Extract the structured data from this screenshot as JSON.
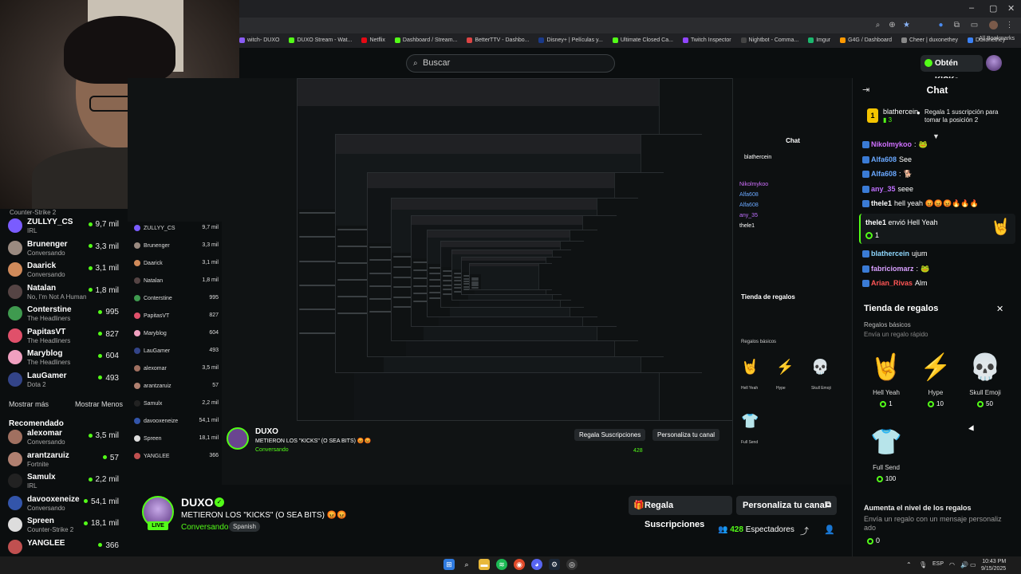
{
  "browser": {
    "tabs_title": "witch- DUXO",
    "bookmarks": [
      {
        "label": "witch- DUXO",
        "color": "#8a5cf5"
      },
      {
        "label": "DUXO Stream - Wat...",
        "color": "#53fc18"
      },
      {
        "label": "Netflix",
        "color": "#e50914"
      },
      {
        "label": "Dashboard / Stream...",
        "color": "#53fc18"
      },
      {
        "label": "BetterTTV - Dashbo...",
        "color": "#d44"
      },
      {
        "label": "Disney+ | Películas y...",
        "color": "#1a3a8a"
      },
      {
        "label": "Ultimate Closed Ca...",
        "color": "#53fc18"
      },
      {
        "label": "Twitch Inspector",
        "color": "#9146ff"
      },
      {
        "label": "Nightbot - Comma...",
        "color": "#444"
      },
      {
        "label": "Imgur",
        "color": "#1bb76e"
      },
      {
        "label": "G4G / Dashboard",
        "color": "#f90"
      },
      {
        "label": "Cheer | duxonethey",
        "color": "#888"
      },
      {
        "label": "Duxonethey",
        "color": "#3b82f6"
      }
    ],
    "all_bookmarks": "All Bookmarks"
  },
  "header": {
    "search_placeholder": "Buscar",
    "kicks_button": "Obtén KICKs"
  },
  "sidebar": {
    "top_category": "Counter-Strike 2",
    "channels": [
      {
        "name": "ZULLYY_CS",
        "game": "IRL",
        "viewers": "9,7 mil",
        "color": "#7a5cff"
      },
      {
        "name": "Brunenger",
        "game": "Conversando",
        "viewers": "3,3 mil",
        "color": "#9a8a80"
      },
      {
        "name": "Daarick",
        "game": "Conversando",
        "viewers": "3,1 mil",
        "color": "#d08a5a"
      },
      {
        "name": "Natalan",
        "game": "No, I'm Not A Human",
        "viewers": "1,8 mil",
        "color": "#554444"
      },
      {
        "name": "Conterstine",
        "game": "The Headliners",
        "viewers": "995",
        "color": "#3f9a4f"
      },
      {
        "name": "PapitasVT",
        "game": "The Headliners",
        "viewers": "827",
        "color": "#e0506a"
      },
      {
        "name": "Maryblog",
        "game": "The Headliners",
        "viewers": "604",
        "color": "#f0a0c0"
      },
      {
        "name": "LauGamer",
        "game": "Dota 2",
        "viewers": "493",
        "color": "#334488"
      }
    ],
    "show_more": "Mostrar más",
    "show_less": "Mostrar Menos",
    "recommended_title": "Recomendado",
    "recommended": [
      {
        "name": "alexomar",
        "game": "Conversando",
        "viewers": "3,5 mil",
        "color": "#a07060"
      },
      {
        "name": "arantzaruiz",
        "game": "Fortnite",
        "viewers": "57",
        "color": "#b08070"
      },
      {
        "name": "Samulx",
        "game": "IRL",
        "viewers": "2,2 mil",
        "color": "#222"
      },
      {
        "name": "davooxeneize",
        "game": "Conversando",
        "viewers": "54,1 mil",
        "color": "#3355aa"
      },
      {
        "name": "Spreen",
        "game": "Counter-Strike 2",
        "viewers": "18,1 mil",
        "color": "#ddd"
      },
      {
        "name": "YANGLEE",
        "game": "",
        "viewers": "366",
        "color": "#c05050"
      }
    ]
  },
  "stream": {
    "channel": "DUXO",
    "live_label": "LIVE",
    "title": "METIERON LOS \"KICKS\" (O SEA BITS) 😡😡",
    "category": "Conversando",
    "language": "Spanish",
    "gift_subs_button": "Regala Suscripciones",
    "customize_button": "Personaliza tu canal",
    "viewers_count": "428",
    "viewers_label": "Espectadores"
  },
  "chat": {
    "title": "Chat",
    "pinned_user": "blathercein",
    "pinned_count": "3",
    "pinned_message": "Regala 1 suscripción para tomar la posición 2",
    "messages": [
      {
        "user": "Nikolmykoo",
        "text": ":",
        "color": "#d070ff",
        "emote": "🐸"
      },
      {
        "user": "Alfa608",
        "text": "See",
        "color": "#6aa8ff",
        "emote": ""
      },
      {
        "user": "Alfa608",
        "text": ":",
        "color": "#6aa8ff",
        "emote": "🐕"
      },
      {
        "user": "any_35",
        "text": "seee",
        "color": "#c070ff",
        "emote": ""
      },
      {
        "user": "thele1",
        "text": "hell yeah 😡😡😡🔥🔥🔥",
        "color": "#ffffff",
        "emote": ""
      }
    ],
    "gift_message": {
      "user": "thele1",
      "text": "envió Hell Yeah",
      "count": "1"
    },
    "messages2": [
      {
        "user": "blathercein",
        "text": "ujum",
        "color": "#8fd8ff"
      },
      {
        "user": "fabriciomarz",
        "text": ":",
        "color": "#d8a0ff",
        "emote": "🐸"
      },
      {
        "user": "Arian_Rivas",
        "text": "Alm",
        "color": "#ff5555"
      }
    ]
  },
  "gift_store": {
    "title": "Tienda de regalos",
    "section1": "Regalos básicos",
    "section1_sub": "Envía un regalo rápido",
    "gifts": [
      {
        "name": "Hell Yeah",
        "price": "1",
        "icon": "🤘"
      },
      {
        "name": "Hype",
        "price": "10",
        "icon": "⚡"
      },
      {
        "name": "Skull Emoji",
        "price": "50",
        "icon": "💀"
      },
      {
        "name": "Full Send",
        "price": "100",
        "icon": "👕"
      }
    ],
    "section2": "Aumenta el nivel de los regalos",
    "section2_sub": "Envía un regalo con un mensaje personaliz ado",
    "section2_count": "0"
  },
  "taskbar": {
    "lang": "ESP",
    "time": "10:43 PM",
    "date": "9/15/2025"
  }
}
